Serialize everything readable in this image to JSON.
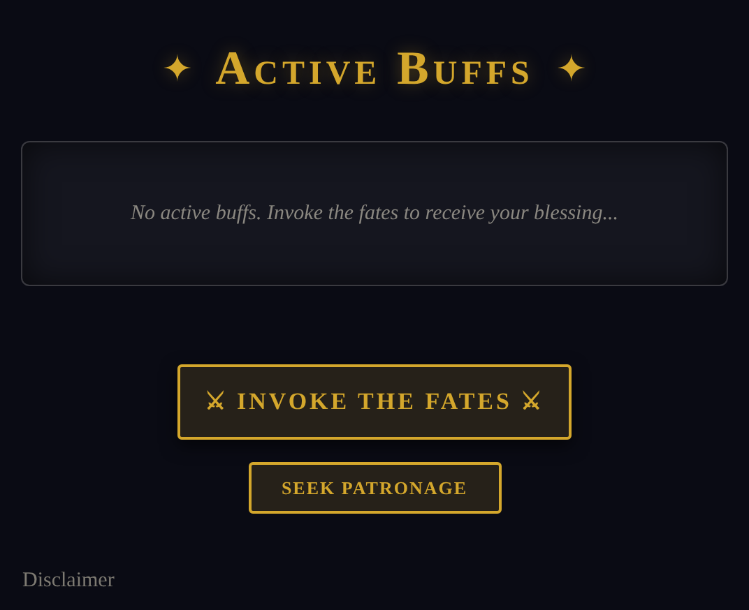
{
  "title": {
    "text": "Active Buffs",
    "ornament_left": "✦",
    "ornament_right": "✦"
  },
  "buffs_panel": {
    "empty_message": "No active buffs. Invoke the fates to receive your blessing..."
  },
  "buttons": [
    {
      "kind": "primary",
      "label": "⚔ INVOKE THE FATES ⚔"
    },
    {
      "kind": "secondary",
      "label": "SEEK PATRONAGE"
    }
  ],
  "footer": {
    "link": "Disclaimer"
  }
}
